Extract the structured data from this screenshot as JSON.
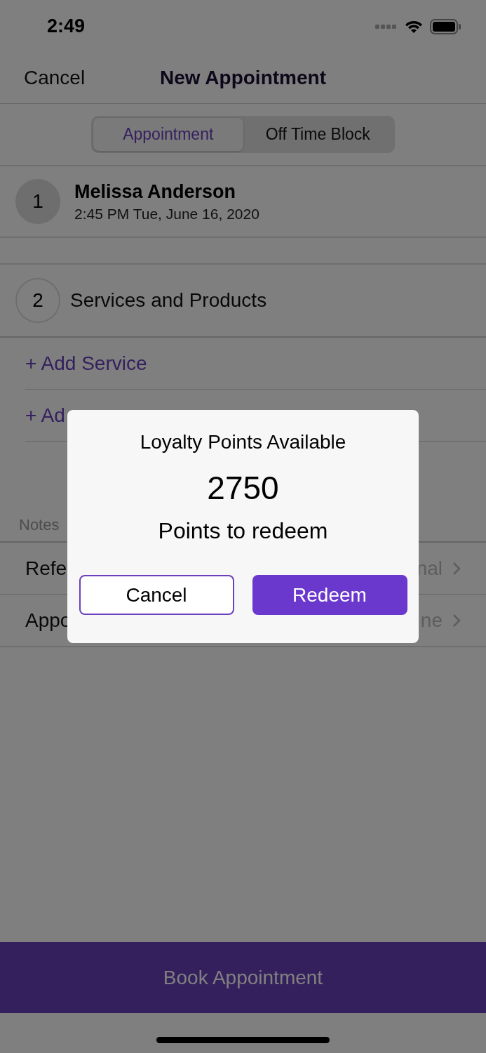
{
  "status_bar": {
    "time": "2:49"
  },
  "nav": {
    "cancel": "Cancel",
    "title": "New Appointment"
  },
  "segments": [
    {
      "label": "Appointment",
      "selected": true
    },
    {
      "label": "Off Time Block",
      "selected": false
    }
  ],
  "client": {
    "step": "1",
    "name": "Melissa Anderson",
    "datetime": "2:45 PM Tue, June 16, 2020"
  },
  "services": {
    "step": "2",
    "title": "Services and Products",
    "actions": [
      "+ Add Service",
      "+ Ad"
    ]
  },
  "notes": {
    "label": "Notes",
    "rows": [
      {
        "label": "Refe",
        "value": "nal"
      },
      {
        "label": "Appo",
        "value": "ne"
      }
    ]
  },
  "dialog": {
    "title": "Loyalty Points Available",
    "points": "2750",
    "subtitle": "Points to redeem",
    "buttons": [
      {
        "label": "Cancel",
        "kind": "secondary"
      },
      {
        "label": "Redeem",
        "kind": "primary"
      }
    ]
  },
  "book_button": "Book Appointment"
}
